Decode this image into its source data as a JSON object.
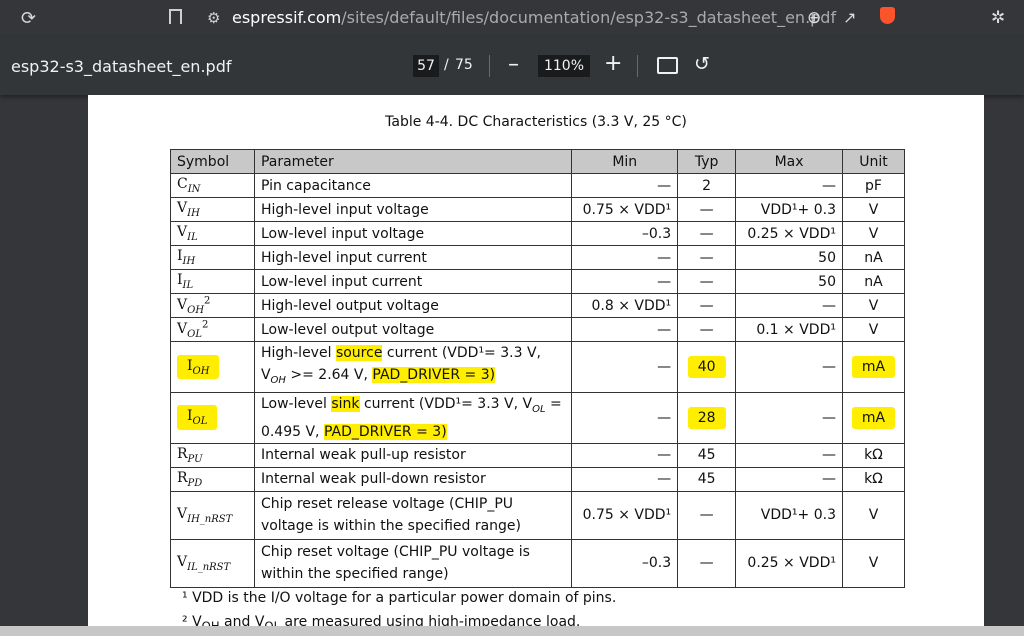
{
  "browser": {
    "reload_icon": "reload-icon",
    "url_host": "espressif.com",
    "url_path": "/sites/default/files/documentation/esp32-s3_datasheet_en.pdf"
  },
  "pdf_toolbar": {
    "title": "esp32-s3_datasheet_en.pdf",
    "page_current": "57",
    "page_sep": "/",
    "page_total": "75",
    "zoom_out": "–",
    "zoom": "110%",
    "zoom_in": "+"
  },
  "page": {
    "caption": "Table 4-4. DC Characteristics (3.3 V, 25 °C)",
    "headers": [
      "Symbol",
      "Parameter",
      "Min",
      "Typ",
      "Max",
      "Unit"
    ],
    "rows": [
      {
        "sym": "C",
        "sub": "IN",
        "sup": "",
        "param": "Pin capacitance",
        "min": "—",
        "typ": "2",
        "max": "—",
        "unit": "pF"
      },
      {
        "sym": "V",
        "sub": "IH",
        "sup": "",
        "param": "High-level input voltage",
        "min": "0.75 × VDD¹",
        "typ": "—",
        "max": "VDD¹+ 0.3",
        "unit": "V"
      },
      {
        "sym": "V",
        "sub": "IL",
        "sup": "",
        "param": "Low-level input voltage",
        "min": "–0.3",
        "typ": "—",
        "max": "0.25 × VDD¹",
        "unit": "V"
      },
      {
        "sym": "I",
        "sub": "IH",
        "sup": "",
        "param": "High-level input current",
        "min": "—",
        "typ": "—",
        "max": "50",
        "unit": "nA"
      },
      {
        "sym": "I",
        "sub": "IL",
        "sup": "",
        "param": "Low-level input current",
        "min": "—",
        "typ": "—",
        "max": "50",
        "unit": "nA"
      },
      {
        "sym": "V",
        "sub": "OH",
        "sup": "2",
        "param": "High-level output voltage",
        "min": "0.8 × VDD¹",
        "typ": "—",
        "max": "—",
        "unit": "V"
      },
      {
        "sym": "V",
        "sub": "OL",
        "sup": "2",
        "param": "Low-level output voltage",
        "min": "—",
        "typ": "—",
        "max": "0.1 × VDD¹",
        "unit": "V"
      },
      {
        "sym": "I",
        "sub": "OH",
        "sup": "",
        "param_a": "High-level ",
        "param_b": "source",
        "param_c": " current (VDD¹= 3.3 V, V",
        "param_sub": "OH",
        "param_d": " >= 2.64 V, ",
        "param_e": "PAD_DRIVER = 3)",
        "min": "—",
        "typ": "40",
        "max": "—",
        "unit": "mA",
        "highlight": true
      },
      {
        "sym": "I",
        "sub": "OL",
        "sup": "",
        "param_a": "Low-level ",
        "param_b": "sink",
        "param_c": " current (VDD¹= 3.3 V, V",
        "param_sub": "OL",
        "param_d": " = 0.495 V, ",
        "param_e": "PAD_DRIVER = 3)",
        "min": "—",
        "typ": "28",
        "max": "—",
        "unit": "mA",
        "highlight": true
      },
      {
        "sym": "R",
        "sub": "PU",
        "sup": "",
        "param": "Internal weak pull-up resistor",
        "min": "—",
        "typ": "45",
        "max": "—",
        "unit": "kΩ"
      },
      {
        "sym": "R",
        "sub": "PD",
        "sup": "",
        "param": "Internal weak pull-down resistor",
        "min": "—",
        "typ": "45",
        "max": "—",
        "unit": "kΩ"
      },
      {
        "sym": "V",
        "sub": "IH_nRST",
        "sup": "",
        "param": "Chip reset release voltage (CHIP_PU voltage is within the specified range)",
        "min": "0.75 × VDD¹",
        "typ": "—",
        "max": "VDD¹+ 0.3",
        "unit": "V"
      },
      {
        "sym": "V",
        "sub": "IL_nRST",
        "sup": "",
        "param": "Chip reset voltage (CHIP_PU voltage is within the specified range)",
        "min": "–0.3",
        "typ": "—",
        "max": "0.25 × VDD¹",
        "unit": "V"
      }
    ],
    "footnote1": "¹ VDD is the I/O voltage for a particular power domain of pins.",
    "footnote2": "² V",
    "footnote2_sub1": "OH",
    "footnote2_mid": " and V",
    "footnote2_sub2": "OL",
    "footnote2_end": " are measured using high-impedance load."
  },
  "colors": {
    "highlight": "#ffee00",
    "toolbar": "#323639"
  }
}
